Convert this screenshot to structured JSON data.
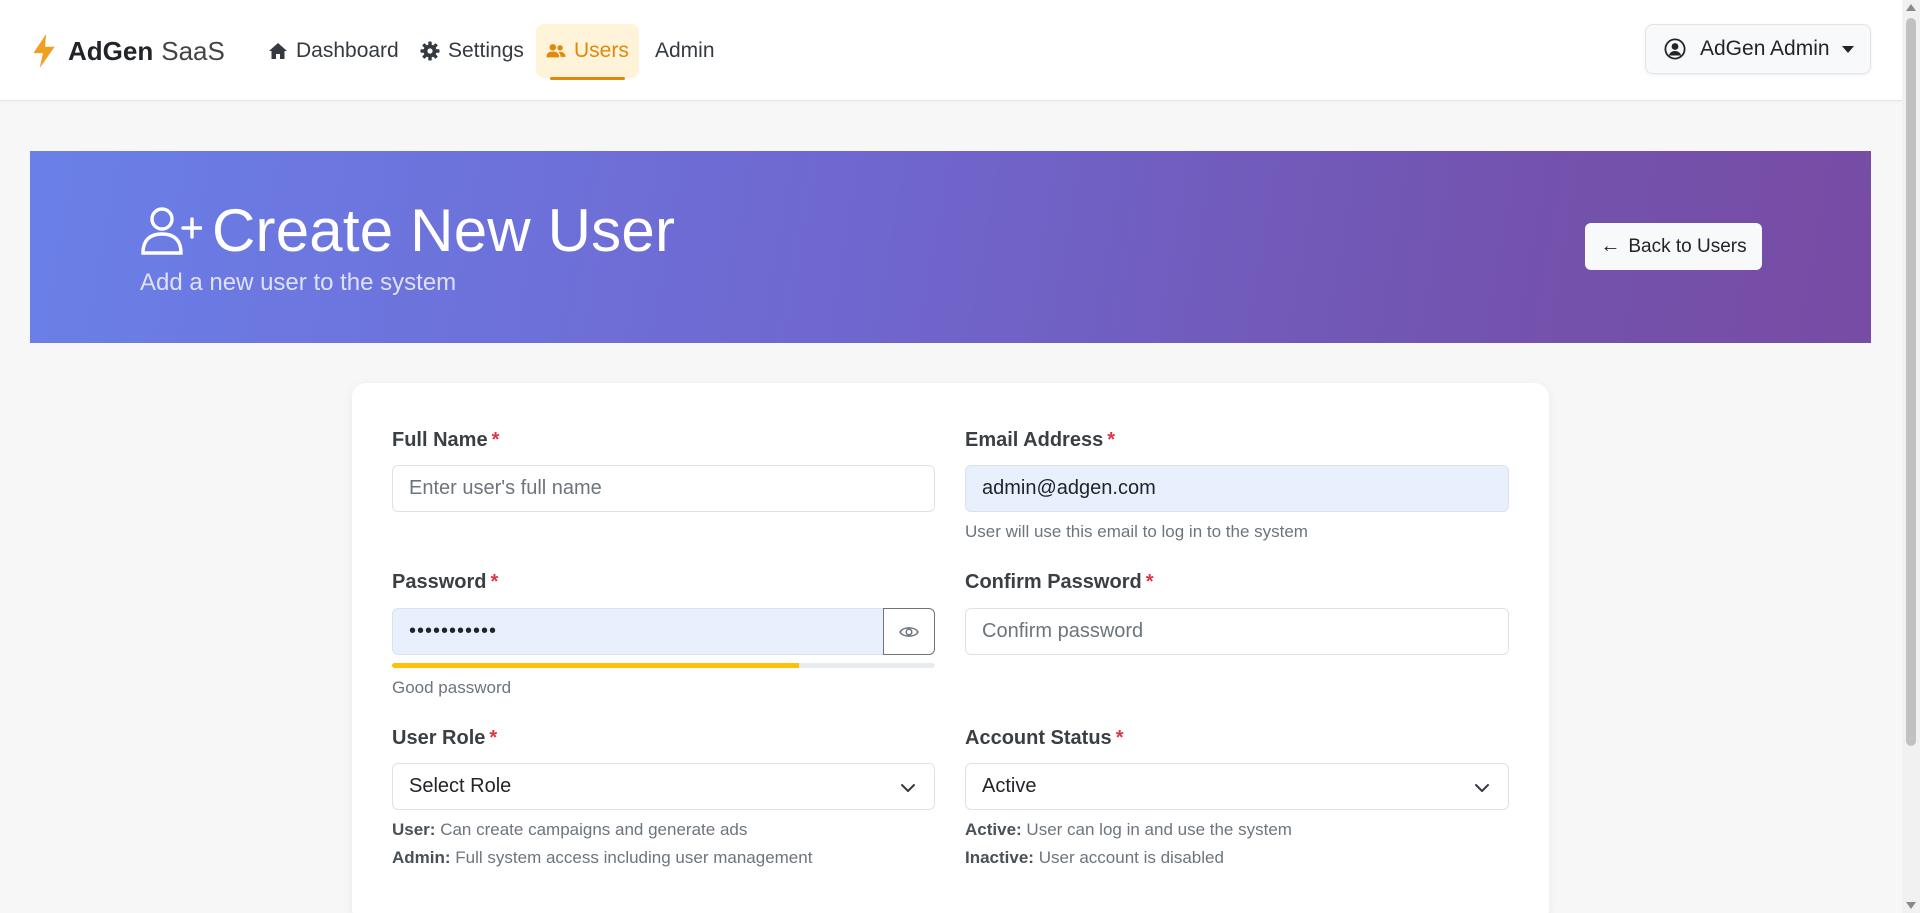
{
  "navbar": {
    "brand_name": "AdGen",
    "brand_sub": "SaaS",
    "items": [
      {
        "label": "Dashboard",
        "icon": "home-icon"
      },
      {
        "label": "Settings",
        "icon": "gear-icon"
      },
      {
        "label": "Users",
        "icon": "users-icon",
        "active": true
      },
      {
        "label": "Admin"
      }
    ],
    "user_menu_label": "AdGen Admin"
  },
  "hero": {
    "title": "Create New User",
    "subtitle": "Add a new user to the system",
    "back_label": "Back to Users"
  },
  "form": {
    "full_name": {
      "label": "Full Name",
      "required": "*",
      "placeholder": "Enter user's full name",
      "value": ""
    },
    "email": {
      "label": "Email Address",
      "required": "*",
      "value": "admin@adgen.com",
      "help": "User will use this email to log in to the system"
    },
    "password": {
      "label": "Password",
      "required": "*",
      "masked_value": "•••••••••••",
      "strength_text": "Good password",
      "strength_level": 0.75
    },
    "confirm_password": {
      "label": "Confirm Password",
      "required": "*",
      "placeholder": "Confirm password"
    },
    "role": {
      "label": "User Role",
      "required": "*",
      "selected": "Select Role",
      "help_1_key": "User:",
      "help_1_text": "Can create campaigns and generate ads",
      "help_2_key": "Admin:",
      "help_2_text": "Full system access including user management"
    },
    "status": {
      "label": "Account Status",
      "required": "*",
      "selected": "Active",
      "help_1_key": "Active:",
      "help_1_text": "User can log in and use the system",
      "help_2_key": "Inactive:",
      "help_2_text": "User account is disabled"
    }
  },
  "colors": {
    "accent": "#e0890a",
    "hero_start": "#6a80e8",
    "hero_end": "#774ca4",
    "strength": "#ffc107",
    "required": "#dc3545"
  }
}
